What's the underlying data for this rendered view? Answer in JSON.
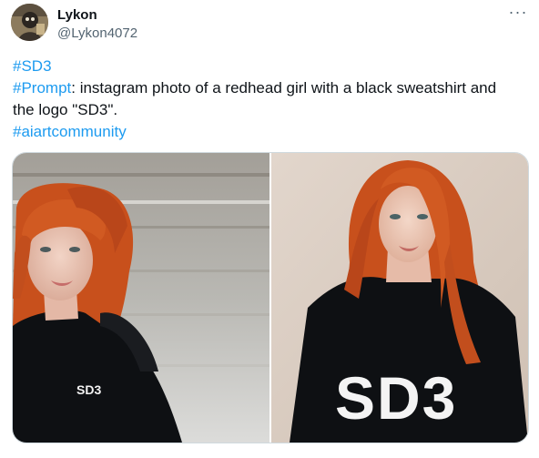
{
  "author": {
    "name": "Lykon",
    "handle": "@Lykon4072",
    "avatar_icon": "avatar-portrait"
  },
  "more_icon": "more-dots-icon",
  "more_glyph": "···",
  "tweet": {
    "hashtag_sd3": "#SD3",
    "hashtag_prompt": "#Prompt",
    "prompt_text": ": instagram photo of a redhead girl with a black sweatshirt and",
    "prompt_text_2": "the logo \"SD3\".",
    "hashtag_community": "#aiartcommunity"
  },
  "media": {
    "left_logo": "SD3",
    "right_logo": "SD3"
  },
  "colors": {
    "link": "#1d9bf0",
    "text": "#0f1419",
    "secondary": "#536471",
    "hair": "#c8501c",
    "sweatshirt": "#0e1013"
  }
}
